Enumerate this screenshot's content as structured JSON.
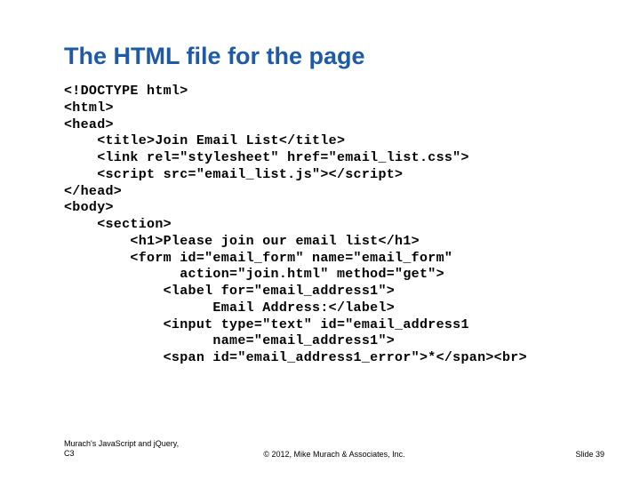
{
  "title": "The HTML file for the page",
  "code_lines": [
    "<!DOCTYPE html>",
    "<html>",
    "<head>",
    "    <title>Join Email List</title>",
    "    <link rel=\"stylesheet\" href=\"email_list.css\">",
    "    <script src=\"email_list.js\"></​script>",
    "</head>",
    "<body>",
    "    <section>",
    "        <h1>Please join our email list</h1>",
    "        <form id=\"email_form\" name=\"email_form\"",
    "              action=\"join.html\" method=\"get\">",
    "            <label for=\"email_address1\">",
    "                  Email Address:</label>",
    "            <input type=\"text\" id=\"email_address1",
    "                  name=\"email_address1\">",
    "            <span id=\"email_address1_error\">*</span><br>"
  ],
  "footer": {
    "left_line1": "Murach's JavaScript and jQuery,",
    "left_line2": "C3",
    "center": "© 2012, Mike Murach & Associates, Inc.",
    "right": "Slide 39"
  }
}
